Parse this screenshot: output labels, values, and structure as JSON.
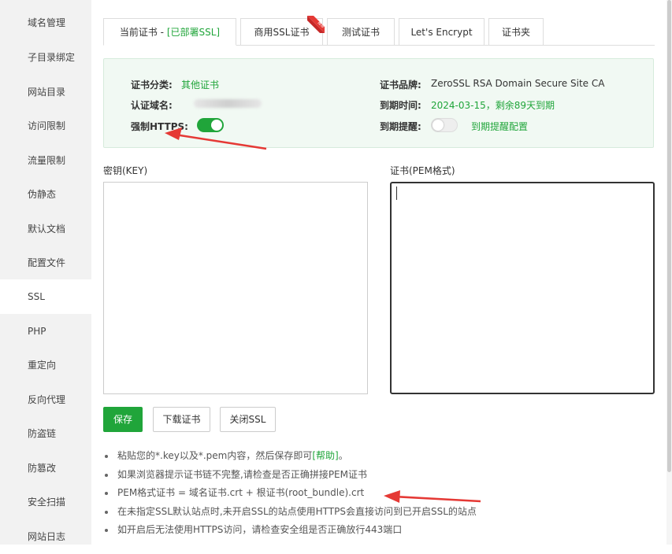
{
  "sidebar": {
    "items": [
      {
        "label": "域名管理"
      },
      {
        "label": "子目录绑定"
      },
      {
        "label": "网站目录"
      },
      {
        "label": "访问限制"
      },
      {
        "label": "流量限制"
      },
      {
        "label": "伪静态"
      },
      {
        "label": "默认文档"
      },
      {
        "label": "配置文件"
      },
      {
        "label": "SSL",
        "active": true
      },
      {
        "label": "PHP"
      },
      {
        "label": "重定向"
      },
      {
        "label": "反向代理"
      },
      {
        "label": "防盗链"
      },
      {
        "label": "防篡改"
      },
      {
        "label": "安全扫描"
      },
      {
        "label": "网站日志"
      }
    ]
  },
  "tabs": {
    "current_prefix": "当前证书 - ",
    "current_status": "[已部署SSL]",
    "commercial": "商用SSL证书",
    "commercial_ribbon": "推荐",
    "test": "测试证书",
    "letsencrypt": "Let's Encrypt",
    "folder": "证书夹"
  },
  "cert_info": {
    "category_label": "证书分类:",
    "category_value": "其他证书",
    "domain_label": "认证域名:",
    "force_https_label": "强制HTTPS:",
    "force_https_on": true,
    "brand_label": "证书品牌:",
    "brand_value": "ZeroSSL RSA Domain Secure Site CA",
    "expiry_label": "到期时间:",
    "expiry_value": "2024-03-15，剩余89天到期",
    "reminder_label": "到期提醒:",
    "reminder_on": false,
    "reminder_link": "到期提醒配置"
  },
  "key_label": "密钥(KEY)",
  "pem_label": "证书(PEM格式)",
  "buttons": {
    "save": "保存",
    "download": "下载证书",
    "close_ssl": "关闭SSL"
  },
  "tips": {
    "tip1_text": "粘贴您的*.key以及*.pem内容，然后保存即可",
    "tip1_link": "[帮助]",
    "tip1_end": "。",
    "tip2": "如果浏览器提示证书链不完整,请检查是否正确拼接PEM证书",
    "tip3": "PEM格式证书 = 域名证书.crt + 根证书(root_bundle).crt",
    "tip4": "在未指定SSL默认站点时,未开启SSL的站点使用HTTPS会直接访问到已开启SSL的站点",
    "tip5": "如开启后无法使用HTTPS访问，请检查安全组是否正确放行443端口"
  },
  "colors": {
    "accent": "#20a53a",
    "annotation_arrow": "#e53935",
    "info_bg": "#f1f9f3"
  }
}
